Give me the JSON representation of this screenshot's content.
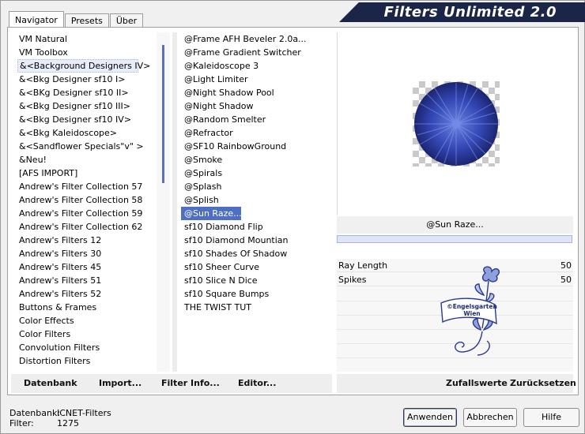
{
  "tabs": [
    "Navigator",
    "Presets",
    "Über"
  ],
  "title": "Filters Unlimited 2.0",
  "categories": [
    "VM Natural",
    "VM Toolbox",
    "&<Background Designers IV>",
    "&<Bkg Designer sf10 I>",
    "&<BKg Designer sf10 II>",
    "&<Bkg Designer sf10 III>",
    "&<Bkg Designer sf10 IV>",
    "&<Bkg Kaleidoscope>",
    "&<Sandflower Specials\"v\" >",
    "&Neu!",
    "[AFS IMPORT]",
    "Andrew's Filter Collection 57",
    "Andrew's Filter Collection 58",
    "Andrew's Filter Collection 59",
    "Andrew's Filter Collection 62",
    "Andrew's Filters 12",
    "Andrew's Filters 30",
    "Andrew's Filters 45",
    "Andrew's Filters 51",
    "Andrew's Filters 52",
    "Buttons & Frames",
    "Color Effects",
    "Color Filters",
    "Convolution Filters",
    "Distortion Filters"
  ],
  "selected_category": "&<Background Designers IV>",
  "filters": [
    "@Frame AFH Beveler 2.0a...",
    "@Frame Gradient Switcher",
    "@Kaleidoscope 3",
    "@Light Limiter",
    "@Night Shadow Pool",
    "@Night Shadow",
    "@Random Smelter",
    "@Refractor",
    "@SF10 RainbowGround",
    "@Smoke",
    "@Spirals",
    "@Splash",
    "@Splish",
    "@Sun Raze...",
    "sf10 Diamond Flip",
    "sf10 Diamond Mountian",
    "sf10 Shades Of Shadow",
    "sf10 Sheer Curve",
    "sf10 Slice N Dice",
    "sf10 Square Bumps",
    "THE TWIST TUT"
  ],
  "selected_filter": "@Sun Raze...",
  "filter_name_display": "@Sun Raze...",
  "params": [
    {
      "label": "Ray Length",
      "value": "50"
    },
    {
      "label": "Spikes",
      "value": "50"
    }
  ],
  "watermark_text": "©Engelsgarten Wien",
  "bottom_left_buttons": [
    "Datenbank",
    "Import...",
    "Filter Info...",
    "Editor..."
  ],
  "bottom_right_buttons": [
    "Zufallswerte",
    "Zurücksetzen"
  ],
  "status": {
    "db_label": "Datenbank:",
    "db_value": "ICNET-Filters",
    "filter_label": "Filter:",
    "filter_value": "1275"
  },
  "dialog_buttons": {
    "apply": "Anwenden",
    "cancel": "Abbrechen",
    "help": "Hilfe"
  },
  "colors": {
    "accent": "#4f6fc4",
    "banner": "#1a2548",
    "preview_sphere": "#2d3fa8"
  },
  "icons": [
    "transparency-checker",
    "sun-raze-preview-sphere",
    "tube-flower-watermark"
  ]
}
